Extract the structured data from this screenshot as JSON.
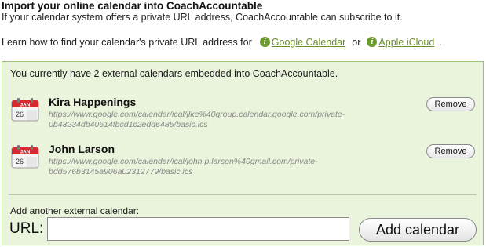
{
  "header": {
    "title": "Import your online calendar into CoachAccountable",
    "subtitle": "If your calendar system offers a private URL address, CoachAccountable can subscribe to it."
  },
  "learn": {
    "prefix": "Learn how to find your calendar's private URL address for",
    "info_icon_glyph": "i",
    "link_google": "Google Calendar",
    "separator": "or",
    "link_apple": "Apple iCloud",
    "suffix": ".",
    "link_color": "#6a8f2a"
  },
  "panel": {
    "intro": "You currently have 2 external calendars embedded into CoachAccountable.",
    "background": "#eaf3dc",
    "calendars": [
      {
        "name": "Kira Happenings",
        "url_line1": "https://www.google.com/calendar/ical/jlke%40group.calendar.google.com/private-",
        "url_line2": "0b43234db40614fbcd1c2edd6485/basic.ics",
        "remove_label": "Remove",
        "icon_month": "JAN",
        "icon_day": "26",
        "icon": "calendar-icon"
      },
      {
        "name": "John Larson",
        "url_line1": "https://www.google.com/calendar/ical/john.p.larson%40gmail.com/private-",
        "url_line2": "bdd576b3145a906a02312779/basic.ics",
        "remove_label": "Remove",
        "icon_month": "JAN",
        "icon_day": "26",
        "icon": "calendar-icon"
      }
    ],
    "add_label": "Add another external calendar:",
    "url_label": "URL:",
    "url_value": "",
    "add_button": "Add calendar"
  }
}
